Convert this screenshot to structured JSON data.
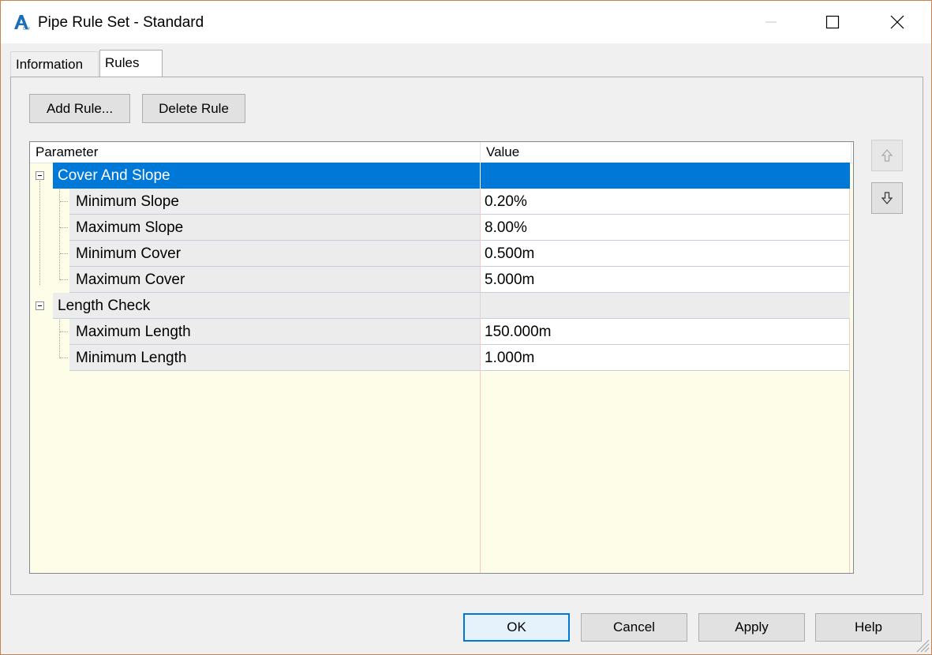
{
  "window": {
    "title": "Pipe Rule Set - Standard"
  },
  "tabs": [
    {
      "label": "Information"
    },
    {
      "label": "Rules"
    }
  ],
  "toolbar": {
    "add_label": "Add Rule...",
    "delete_label": "Delete Rule"
  },
  "grid": {
    "headers": {
      "parameter": "Parameter",
      "value": "Value"
    },
    "groups": [
      {
        "label": "Cover And Slope",
        "selected": true,
        "rows": [
          {
            "parameter": "Minimum Slope",
            "value": "0.20%"
          },
          {
            "parameter": "Maximum Slope",
            "value": "8.00%"
          },
          {
            "parameter": "Minimum Cover",
            "value": "0.500m"
          },
          {
            "parameter": "Maximum Cover",
            "value": "5.000m"
          }
        ]
      },
      {
        "label": "Length Check",
        "selected": false,
        "rows": [
          {
            "parameter": "Maximum Length",
            "value": "150.000m"
          },
          {
            "parameter": "Minimum Length",
            "value": "1.000m"
          }
        ]
      }
    ]
  },
  "side_buttons": {
    "up_icon": "arrow-up-icon",
    "down_icon": "arrow-down-icon"
  },
  "footer": {
    "ok": "OK",
    "cancel": "Cancel",
    "apply": "Apply",
    "help": "Help"
  },
  "colors": {
    "selection": "#0078d7",
    "grid_background": "#fefee8",
    "window_border": "#c7824f"
  }
}
